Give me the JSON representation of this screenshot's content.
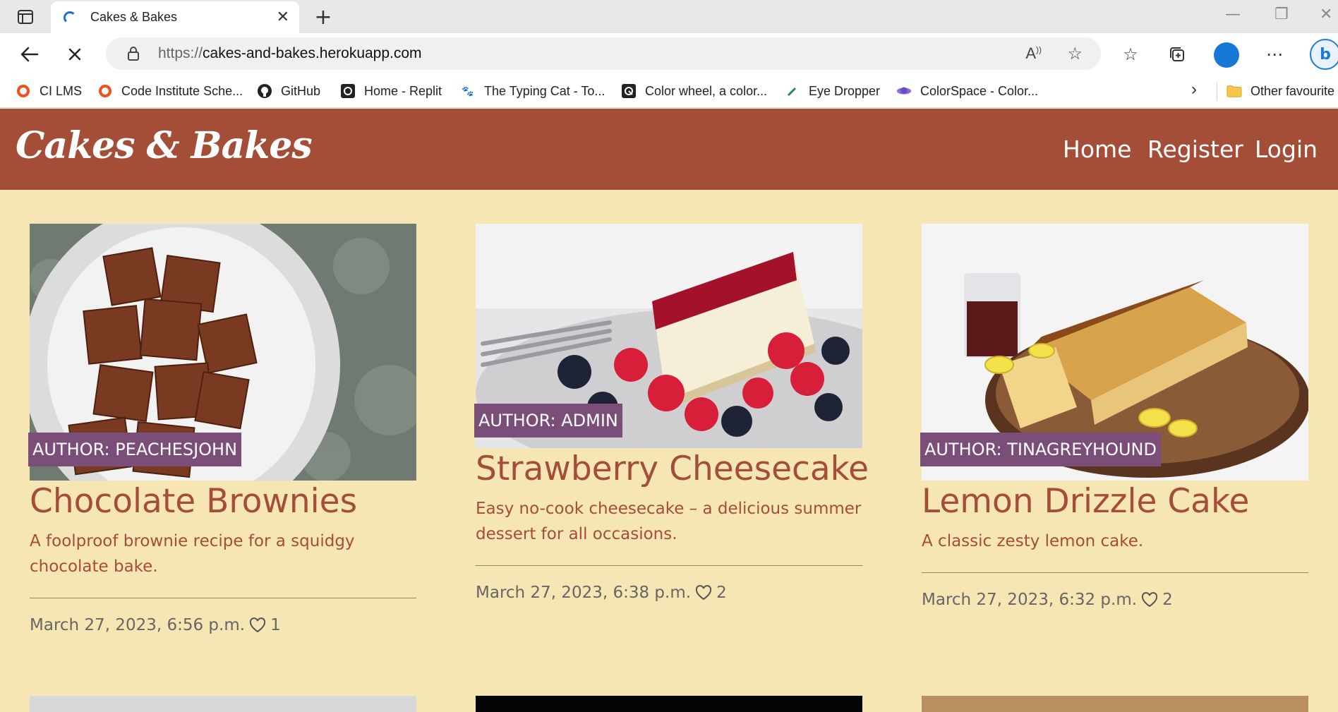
{
  "browser": {
    "tab_title": "Cakes & Bakes",
    "url_protocol": "https://",
    "url_host": "cakes-and-bakes.herokuapp.com",
    "bookmarks": [
      {
        "label": "CI LMS",
        "icon": "ring-icon"
      },
      {
        "label": "Code Institute Sche...",
        "icon": "ring-icon"
      },
      {
        "label": "GitHub",
        "icon": "github-icon"
      },
      {
        "label": "Home - Replit",
        "icon": "replit-icon"
      },
      {
        "label": "The Typing Cat - To...",
        "icon": "paw-icon"
      },
      {
        "label": "Color wheel, a color...",
        "icon": "color-wheel-icon"
      },
      {
        "label": "Eye Dropper",
        "icon": "eyedropper-icon"
      },
      {
        "label": "ColorSpace - Color...",
        "icon": "colorspace-icon"
      }
    ],
    "other_favourites": "Other favourite"
  },
  "site": {
    "brand": "Cakes & Bakes",
    "nav": {
      "home": "Home",
      "register": "Register",
      "login": "Login"
    },
    "colors": {
      "nav": "#a44e38",
      "background": "#f5e6b3",
      "author_badge": "#7a4e78",
      "title": "#a44e38"
    },
    "posts": [
      {
        "author": "AUTHOR: PEACHESJOHN",
        "title": "Chocolate Brownies",
        "excerpt": "A foolproof brownie recipe for a squidgy chocolate bake.",
        "date": "March 27, 2023, 6:56 p.m.",
        "likes": "1"
      },
      {
        "author": "AUTHOR: ADMIN",
        "title": "Strawberry Cheesecake",
        "excerpt": "Easy no-cook cheesecake – a delicious summer dessert for all occasions.",
        "date": "March 27, 2023, 6:38 p.m.",
        "likes": "2"
      },
      {
        "author": "AUTHOR: TINAGREYHOUND",
        "title": "Lemon Drizzle Cake",
        "excerpt": "A classic zesty lemon cake.",
        "date": "March 27, 2023, 6:32 p.m.",
        "likes": "2"
      }
    ]
  }
}
